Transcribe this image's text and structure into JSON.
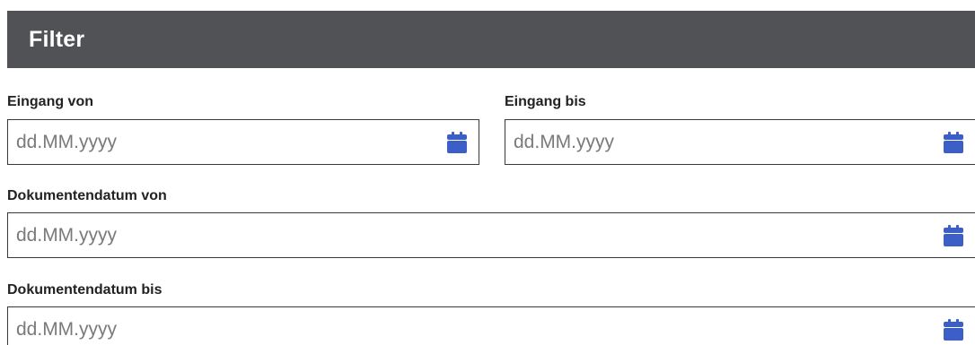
{
  "header": {
    "title": "Filter"
  },
  "fields": [
    {
      "label": "Eingang von",
      "placeholder": "dd.MM.yyyy",
      "value": "",
      "icon": "calendar-icon"
    },
    {
      "label": "Eingang bis",
      "placeholder": "dd.MM.yyyy",
      "value": "",
      "icon": "calendar-icon"
    },
    {
      "label": "Dokumentendatum von",
      "placeholder": "dd.MM.yyyy",
      "value": "",
      "icon": "calendar-icon"
    },
    {
      "label": "Dokumentendatum bis",
      "placeholder": "dd.MM.yyyy",
      "value": "",
      "icon": "calendar-icon"
    }
  ],
  "colors": {
    "header_background": "#515255",
    "header_text": "#ffffff",
    "calendar_icon": "#3b5fc7"
  }
}
